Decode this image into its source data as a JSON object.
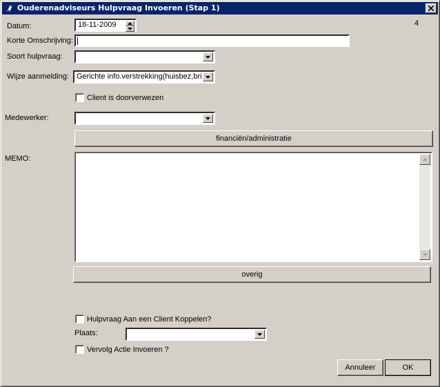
{
  "window": {
    "title": "Ouderenadviseurs Hulpvraag Invoeren (Stap 1)",
    "counter": "4"
  },
  "labels": {
    "datum": "Datum:",
    "korte_omschrijving": "Korte Omschrijving:",
    "soort_hulpvraag": "Soort hulpvraag:",
    "wijze_aanmelding": "Wijze aanmelding:",
    "medewerker": "Medewerker:",
    "memo": "MEMO:",
    "plaats": "Plaats:"
  },
  "fields": {
    "datum_value": "18-11-2009",
    "korte_omschrijving_value": "",
    "soort_hulpvraag_value": "",
    "wijze_aanmelding_value": "Gerichte info.verstrekking(huisbez,brief",
    "medewerker_value": "",
    "memo_value": "",
    "plaats_value": ""
  },
  "checkboxes": {
    "doorverwezen": {
      "label": "Client is doorverwezen",
      "checked": false
    },
    "koppelen": {
      "label": "Hulpvraag Aan een Client Koppelen?",
      "checked": false
    },
    "vervolg": {
      "label": "Vervolg Actie Invoeren ?",
      "checked": false
    }
  },
  "buttons": {
    "financien": "financiën/administratie",
    "overig": "overig",
    "annuleer": "Annuleer",
    "ok": "OK"
  },
  "icons": {
    "title_icon": "app-icon",
    "close": "close-icon",
    "dropdown": "chevron-down-icon"
  }
}
